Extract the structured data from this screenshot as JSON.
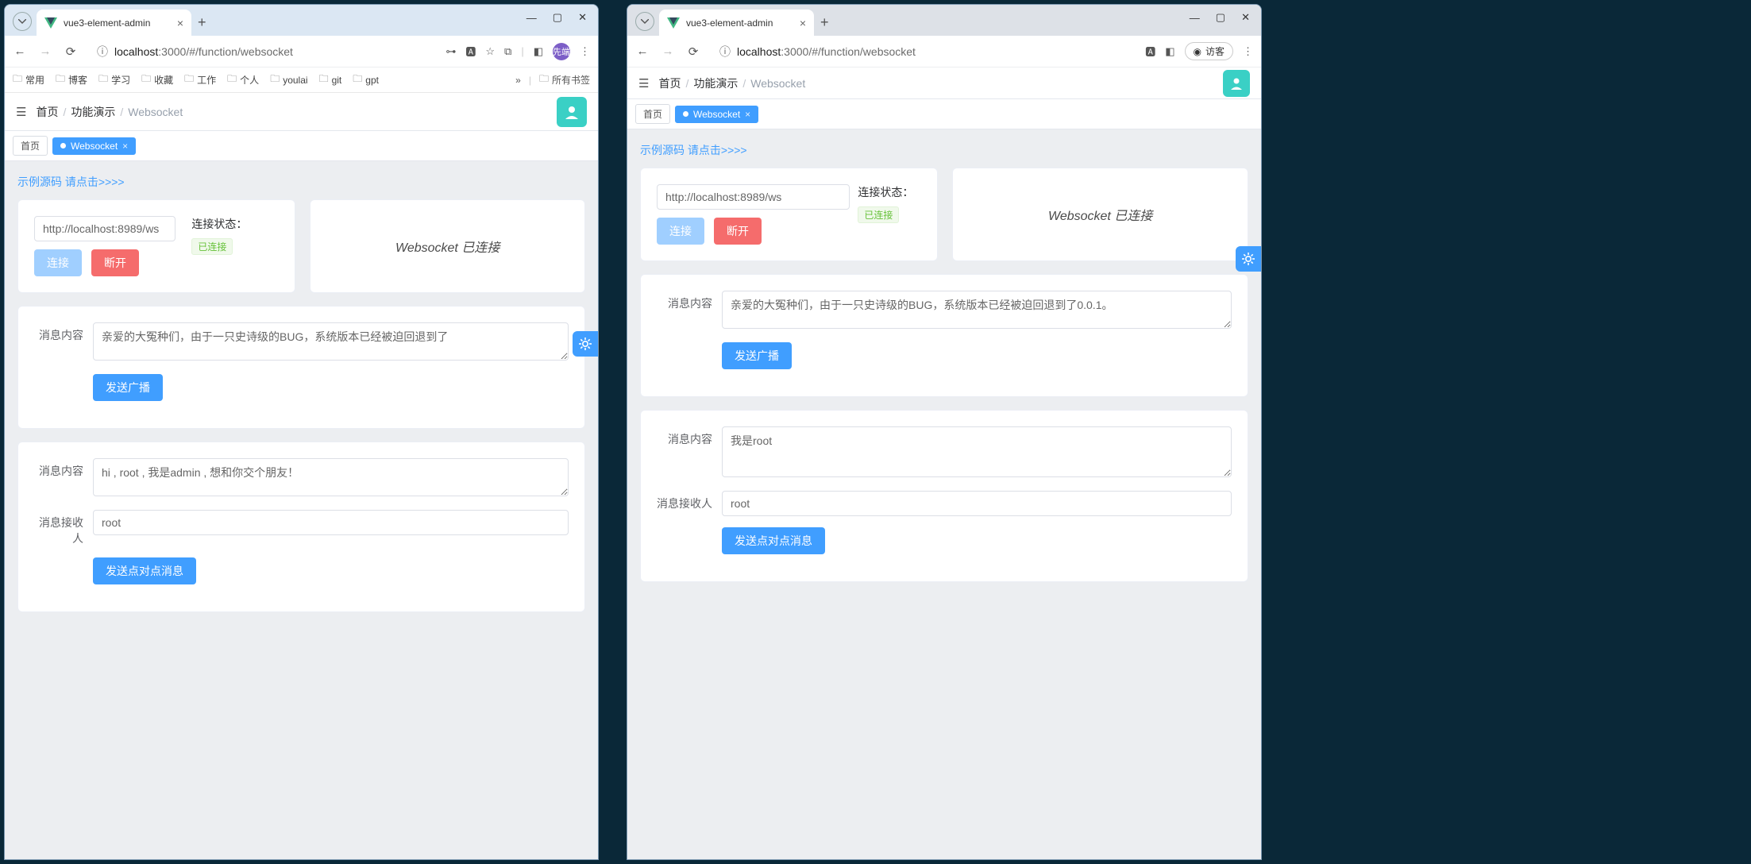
{
  "tab_title": "vue3-element-admin",
  "url_info_icon": "ⓘ",
  "url_host": "localhost",
  "url_port": ":3000",
  "url_path": "/#/function/websocket",
  "left": {
    "bookmarks": [
      "常用",
      "博客",
      "学习",
      "收藏",
      "工作",
      "个人",
      "youlai",
      "git",
      "gpt"
    ],
    "bookmarks_all": "所有书签",
    "breadcrumb": [
      "首页",
      "功能演示",
      "Websocket"
    ],
    "tabs": {
      "home": "首页",
      "ws": "Websocket"
    },
    "source_link": "示例源码 请点击>>>>",
    "ws_url": "http://localhost:8989/ws",
    "btn_connect": "连接",
    "btn_disconnect": "断开",
    "status_label": "连接状态：",
    "status_value": "已连接",
    "ws_status_text": "Websocket 已连接",
    "label_msg": "消息内容",
    "broadcast_value": "亲爱的大冤种们，由于一只史诗级的BUG，系统版本已经被迫回退到了",
    "btn_broadcast": "发送广播",
    "p2p_value": "hi , root , 我是admin , 想和你交个朋友！",
    "label_receiver": "消息接收人",
    "receiver_value": "root",
    "btn_p2p": "发送点对点消息",
    "profile_badge": "先端"
  },
  "right": {
    "guest_label": "访客",
    "breadcrumb": [
      "首页",
      "功能演示",
      "Websocket"
    ],
    "tabs": {
      "home": "首页",
      "ws": "Websocket"
    },
    "source_link": "示例源码 请点击>>>>",
    "ws_url": "http://localhost:8989/ws",
    "btn_connect": "连接",
    "btn_disconnect": "断开",
    "status_label": "连接状态：",
    "status_value": "已连接",
    "ws_status_text": "Websocket 已连接",
    "label_msg": "消息内容",
    "broadcast_value": "亲爱的大冤种们，由于一只史诗级的BUG，系统版本已经被迫回退到了0.0.1。",
    "btn_broadcast": "发送广播",
    "p2p_value": "我是root",
    "label_receiver": "消息接收人",
    "receiver_value": "root",
    "btn_p2p": "发送点对点消息"
  }
}
